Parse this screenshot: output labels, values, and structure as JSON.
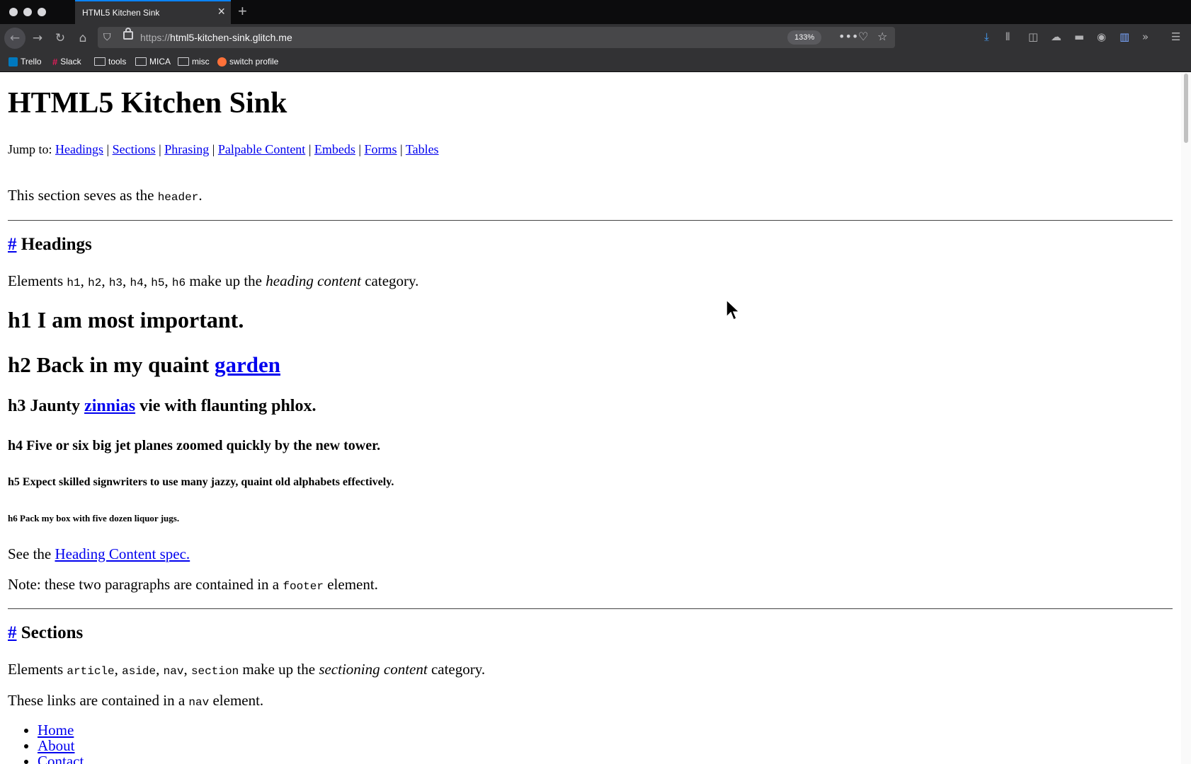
{
  "browser": {
    "tab_title": "HTML5 Kitchen Sink",
    "tab_close": "×",
    "new_tab": "+",
    "url_protocol": "https://",
    "url_host": "html5-kitchen-sink.glitch.me",
    "zoom": "133%",
    "bookmarks": [
      {
        "label": "Trello",
        "icon": "trello-icon"
      },
      {
        "label": "Slack",
        "icon": "slack-icon"
      },
      {
        "label": "tools",
        "icon": "folder-icon"
      },
      {
        "label": "MICA",
        "icon": "folder-icon"
      },
      {
        "label": "misc",
        "icon": "folder-icon"
      },
      {
        "label": "switch profile",
        "icon": "firefox-icon"
      }
    ]
  },
  "page": {
    "title": "HTML5 Kitchen Sink",
    "jump_label": "Jump to:",
    "jump_links": [
      "Headings",
      "Sections",
      "Phrasing",
      "Palpable Content",
      "Embeds",
      "Forms",
      "Tables"
    ],
    "separator": "|",
    "header_note": {
      "before": "This section seves as the",
      "code": "header",
      "after": "."
    },
    "headings_section": {
      "hash": "#",
      "title": "Headings",
      "intro": {
        "before": "Elements",
        "codes": [
          "h1",
          "h2",
          "h3",
          "h4",
          "h5",
          "h6"
        ],
        "middle": "make up the",
        "em": "heading content",
        "after": "category."
      },
      "h1": "h1 I am most important.",
      "h2_text": "h2 Back in my quaint",
      "h2_link": "garden",
      "h3_text": "h3 Jaunty",
      "h3_link": "zinnias",
      "h3_after": "vie with flaunting phlox.",
      "h4": "h4 Five or six big jet planes zoomed quickly by the new tower.",
      "h5": "h5 Expect skilled signwriters to use many jazzy, quaint old alphabets effectively.",
      "h6": "h6 Pack my box with five dozen liquor jugs.",
      "see_before": "See the",
      "see_link": "Heading Content spec.",
      "note": {
        "before": "Note: these two paragraphs are contained in a",
        "code": "footer",
        "after": "element."
      }
    },
    "sections_section": {
      "hash": "#",
      "title": "Sections",
      "intro": {
        "before": "Elements",
        "codes": [
          "article",
          "aside",
          "nav",
          "section"
        ],
        "middle": "make up the",
        "em": "sectioning content",
        "after": "category."
      },
      "nav_note": {
        "before": "These links are contained in a",
        "code": "nav",
        "after": "element."
      },
      "nav_links": [
        "Home",
        "About",
        "Contact"
      ]
    }
  }
}
